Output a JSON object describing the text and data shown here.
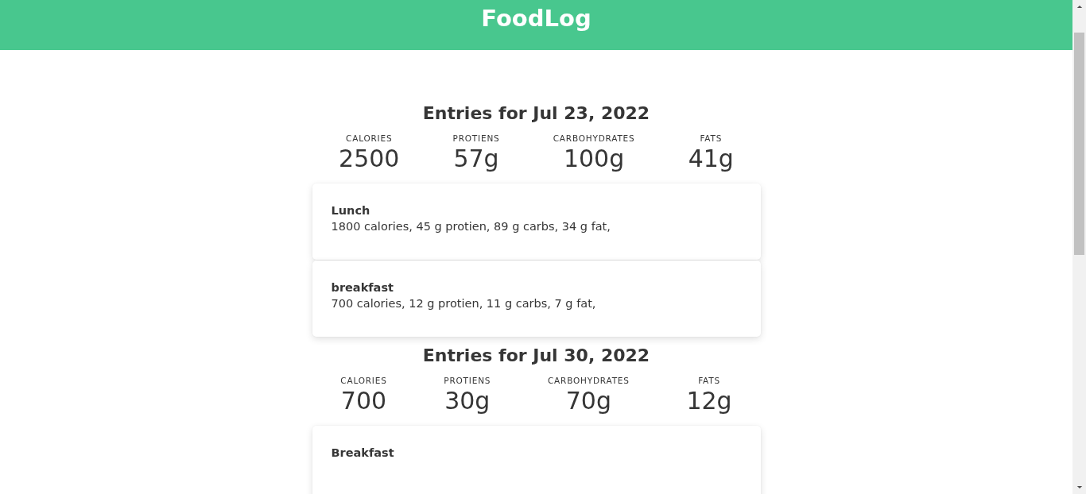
{
  "header": {
    "title": "FoodLog"
  },
  "days": [
    {
      "heading": "Entries for Jul 23, 2022",
      "totals": [
        {
          "label": "CALORIES",
          "value": "2500"
        },
        {
          "label": "PROTIENS",
          "value": "57g"
        },
        {
          "label": "CARBOHYDRATES",
          "value": "100g"
        },
        {
          "label": "FATS",
          "value": "41g"
        }
      ],
      "entries": [
        {
          "name": "Lunch",
          "summary": "1800 calories, 45 g protien, 89 g carbs, 34 g fat,"
        },
        {
          "name": "breakfast",
          "summary": "700 calories, 12 g protien, 11 g carbs, 7 g fat,"
        }
      ]
    },
    {
      "heading": "Entries for Jul 30, 2022",
      "totals": [
        {
          "label": "CALORIES",
          "value": "700"
        },
        {
          "label": "PROTIENS",
          "value": "30g"
        },
        {
          "label": "CARBOHYDRATES",
          "value": "70g"
        },
        {
          "label": "FATS",
          "value": "12g"
        }
      ],
      "entries": [
        {
          "name": "Breakfast"
        }
      ]
    }
  ]
}
